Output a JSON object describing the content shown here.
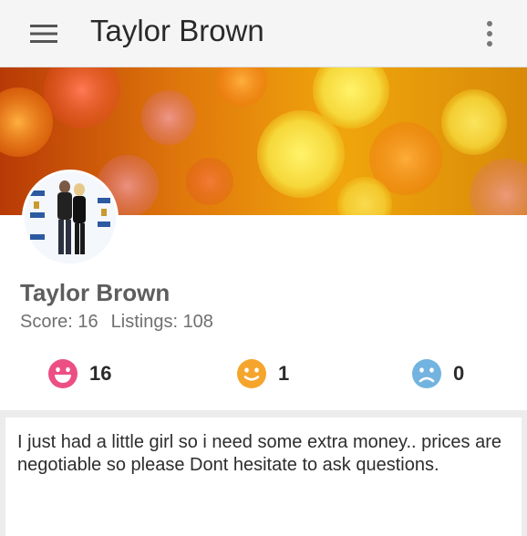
{
  "appbar": {
    "title": "Taylor Brown",
    "menu_icon": "hamburger-menu-icon",
    "overflow_icon": "more-vert-icon"
  },
  "profile": {
    "name": "Taylor Brown",
    "score_label": "Score:",
    "score": "16",
    "listings_label": "Listings:",
    "listings": "108"
  },
  "ratings": [
    {
      "icon": "happy-face-icon",
      "color": "#ec4f84",
      "count": "16"
    },
    {
      "icon": "neutral-face-icon",
      "color": "#f6a52c",
      "count": "1"
    },
    {
      "icon": "sad-face-icon",
      "color": "#73b3df",
      "count": "0"
    }
  ],
  "bio": {
    "text": "I just had a little girl so i need some extra money.. prices are  negotiable so please Dont hesitate to ask questions."
  },
  "colors": {
    "appbar_bg": "#f5f5f5",
    "page_bg": "#ececec",
    "cover_base": "#d35a08"
  }
}
